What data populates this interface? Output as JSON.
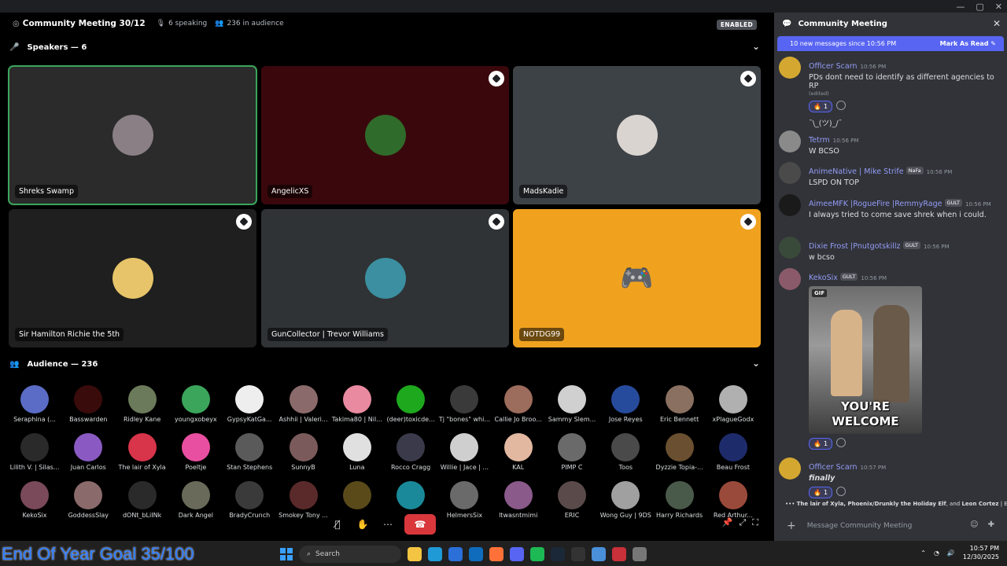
{
  "header": {
    "title": "Community Meeting 30/12",
    "speaking": "6 speaking",
    "audience_count": "236 in audience",
    "enabled_badge": "ENABLED"
  },
  "speakers_section": {
    "label": "Speakers — 6"
  },
  "speakers": [
    {
      "name": "Shreks Swamp",
      "bg": "#2b2b2b",
      "avatar": "#8a7f84",
      "speaking": true,
      "pinned": false
    },
    {
      "name": "AngelicXS",
      "bg": "#3a080c",
      "avatar": "#2f6b2a",
      "speaking": false,
      "pinned": true
    },
    {
      "name": "MadsKadie",
      "bg": "#3d4247",
      "avatar": "#d9d4cf",
      "speaking": false,
      "pinned": true
    },
    {
      "name": "Sir Hamilton Richie the 5th",
      "bg": "#1f1f1f",
      "avatar": "#e7c469",
      "speaking": false,
      "pinned": true
    },
    {
      "name": "GunCollector | Trevor Williams",
      "bg": "#2f3335",
      "avatar": "#3b8fa0",
      "speaking": false,
      "pinned": true
    },
    {
      "name": "NOTDG99",
      "bg": "#f0a21f",
      "avatar": "#f0a21f",
      "speaking": false,
      "pinned": true
    }
  ],
  "audience_section": {
    "label": "Audience — 236"
  },
  "audience": [
    {
      "name": "Seraphina (...",
      "color": "#5a6cc5"
    },
    {
      "name": "Basswarden",
      "color": "#3a0b0b"
    },
    {
      "name": "Ridley Kane",
      "color": "#6b7a5a"
    },
    {
      "name": "youngxobeyx",
      "color": "#3ba55c"
    },
    {
      "name": "GypsyKatGa...",
      "color": "#eeeeee"
    },
    {
      "name": "Ashhii | Valeri...",
      "color": "#8a6a6a"
    },
    {
      "name": "Takima80 | Nil...",
      "color": "#e98aa0"
    },
    {
      "name": "(deer)toxicde...",
      "color": "#1ea81e"
    },
    {
      "name": "Tj \"bones\" whi...",
      "color": "#3a3a3a"
    },
    {
      "name": "Callie Jo Broo...",
      "color": "#9c6c5c"
    },
    {
      "name": "Sammy Slem...",
      "color": "#d0d0d0"
    },
    {
      "name": "Jose Reyes",
      "color": "#274b9c"
    },
    {
      "name": "Eric Bennett",
      "color": "#8a7060"
    },
    {
      "name": "xPlagueGodx",
      "color": "#b0b0b0"
    },
    {
      "name": "Lilith V. | Silas...",
      "color": "#2a2a2a"
    },
    {
      "name": "Juan Carlos",
      "color": "#8a5ac2"
    },
    {
      "name": "The lair of Xyla",
      "color": "#d8344a"
    },
    {
      "name": "Poeltje",
      "color": "#e94fa0"
    },
    {
      "name": "Stan Stephens",
      "color": "#5a5a5a"
    },
    {
      "name": "SunnyB",
      "color": "#7a5a5a"
    },
    {
      "name": "Luna",
      "color": "#e0e0e0"
    },
    {
      "name": "Rocco Cragg",
      "color": "#3a3a4a"
    },
    {
      "name": "Willie | Jace | ...",
      "color": "#cfcfcf"
    },
    {
      "name": "KAL",
      "color": "#e2b8a0"
    },
    {
      "name": "PIMP C",
      "color": "#6a6a6a"
    },
    {
      "name": "Toos",
      "color": "#4a4a4a"
    },
    {
      "name": "Dyzzie Topia-...",
      "color": "#6a5030"
    },
    {
      "name": "Beau Frost",
      "color": "#1e2b6b"
    },
    {
      "name": "KekoSix",
      "color": "#7a4a5a"
    },
    {
      "name": "GoddessSlay",
      "color": "#8a6a6a"
    },
    {
      "name": "dONt_bLiINk",
      "color": "#2a2a2a"
    },
    {
      "name": "Dark Angel",
      "color": "#6a6a5a"
    },
    {
      "name": "BradyCrunch",
      "color": "#3a3a3a"
    },
    {
      "name": "Smokey Tony ...",
      "color": "#5a2a2a"
    },
    {
      "name": "",
      "color": "#5a4a1a"
    },
    {
      "name": "",
      "color": "#1a8a9a"
    },
    {
      "name": "HelmersSix",
      "color": "#6a6a6a"
    },
    {
      "name": "ltwasntmimi",
      "color": "#8a5a8a"
    },
    {
      "name": "ERIC",
      "color": "#5a4a4a"
    },
    {
      "name": "Wong Guy | 9DS",
      "color": "#a0a0a0"
    },
    {
      "name": "Harry Richards",
      "color": "#4a5a4a"
    },
    {
      "name": "Red Arthur...",
      "color": "#9a4a3a"
    }
  ],
  "chat": {
    "title": "Community Meeting",
    "new_messages": "10 new messages since 10:56 PM",
    "mark_read": "Mark As Read",
    "messages": [
      {
        "user": "Officer Scarn",
        "time": "10:56 PM",
        "text": "PDs dont need to identify as different agencies to RP",
        "edited": "(edited)",
        "reaction": "1",
        "extra": "¯\\_(ツ)_/¯",
        "avatar": "#d4a830"
      },
      {
        "user": "Tetrm",
        "time": "10:56 PM",
        "text": "W BCSO",
        "avatar": "#8a8a8a"
      },
      {
        "user": "AnimeNative | Mike Strife",
        "tag": "NaFa",
        "time": "10:56 PM",
        "text": "LSPD ON TOP",
        "avatar": "#4a4a4a"
      },
      {
        "user": "AimeeMFK |RogueFire |RemmyRage",
        "tag": "GULT",
        "time": "10:56 PM",
        "text": "I always tried to come save shrek when i could.",
        "avatar": "#1a1a1a"
      },
      {
        "user": "Dixie Frost |Pnutgotskillz",
        "tag": "GULT",
        "time": "10:56 PM",
        "text": "w bcso",
        "avatar": "#3a4a3a"
      },
      {
        "user": "KekoSix",
        "tag": "GULT",
        "time": "10:56 PM",
        "gif_badge": "GIF",
        "gif_caption": "YOU'RE WELCOME",
        "reaction": "1",
        "avatar": "#8a5a6a"
      },
      {
        "user": "Officer Scarn",
        "time": "10:57 PM",
        "text": "finally",
        "reaction": "1",
        "avatar": "#d4a830"
      }
    ],
    "typing_names": "The lair of Xyla, Phoenix/Drunkly the Holiday Elf",
    "typing_and": ", and ",
    "typing_last": "Leon Cortez",
    "typing_suffix": " | Eren ar...",
    "composer_placeholder": "Message Community Meeting"
  },
  "taskbar": {
    "overlay": "End Of Year Goal 35/100",
    "search": "Search",
    "time": "10:57 PM",
    "date": "12/30/2025"
  }
}
